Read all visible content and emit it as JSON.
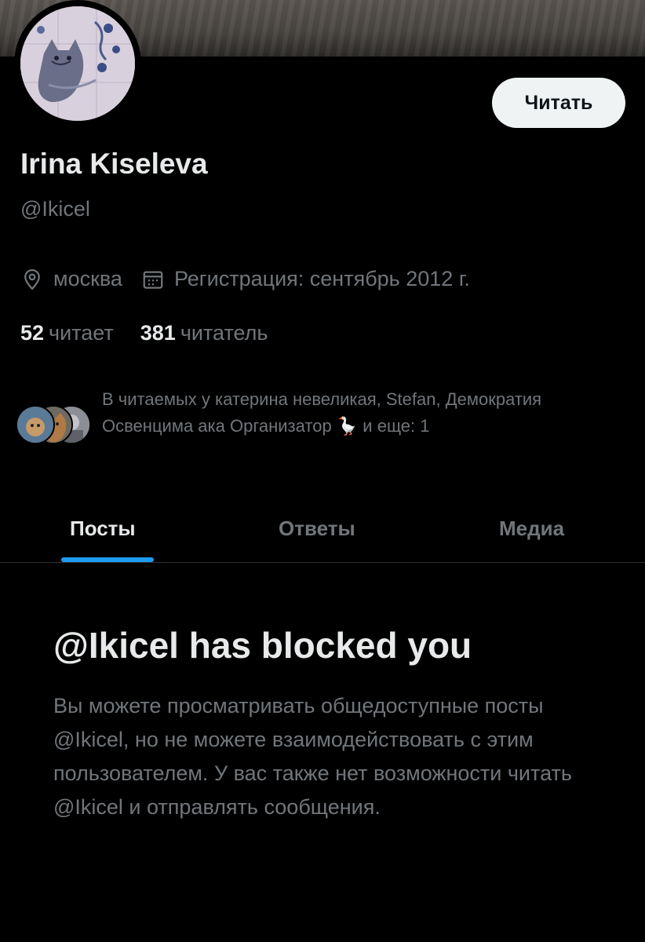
{
  "profile": {
    "name": "Irina Kiseleva",
    "handle": "@Ikicel",
    "location": "москва",
    "joined": "Регистрация: сентябрь 2012 г.",
    "following_count": "52",
    "following_label": "читает",
    "followers_count": "381",
    "followers_label": "читатель"
  },
  "actions": {
    "follow_label": "Читать"
  },
  "followers_you_know": {
    "text": "В читаемых у катерина невеликая, Stefan, Демократия Освенцима ака Организатор 🪿 и еще: 1"
  },
  "tabs": [
    {
      "label": "Посты",
      "active": true
    },
    {
      "label": "Ответы",
      "active": false
    },
    {
      "label": "Медиа",
      "active": false
    }
  ],
  "blocked": {
    "title": "@Ikicel has blocked you",
    "description": "Вы можете просматривать общедоступные посты @Ikicel, но не можете взаимодействовать с этим пользователем. У вас также нет возможности читать @Ikicel и отправлять сообщения."
  },
  "icons": {
    "location": "location-pin-icon",
    "calendar": "calendar-icon"
  },
  "colors": {
    "background": "#000000",
    "text_primary": "#e7e9ea",
    "text_secondary": "#71767b",
    "accent": "#1d9bf0"
  }
}
